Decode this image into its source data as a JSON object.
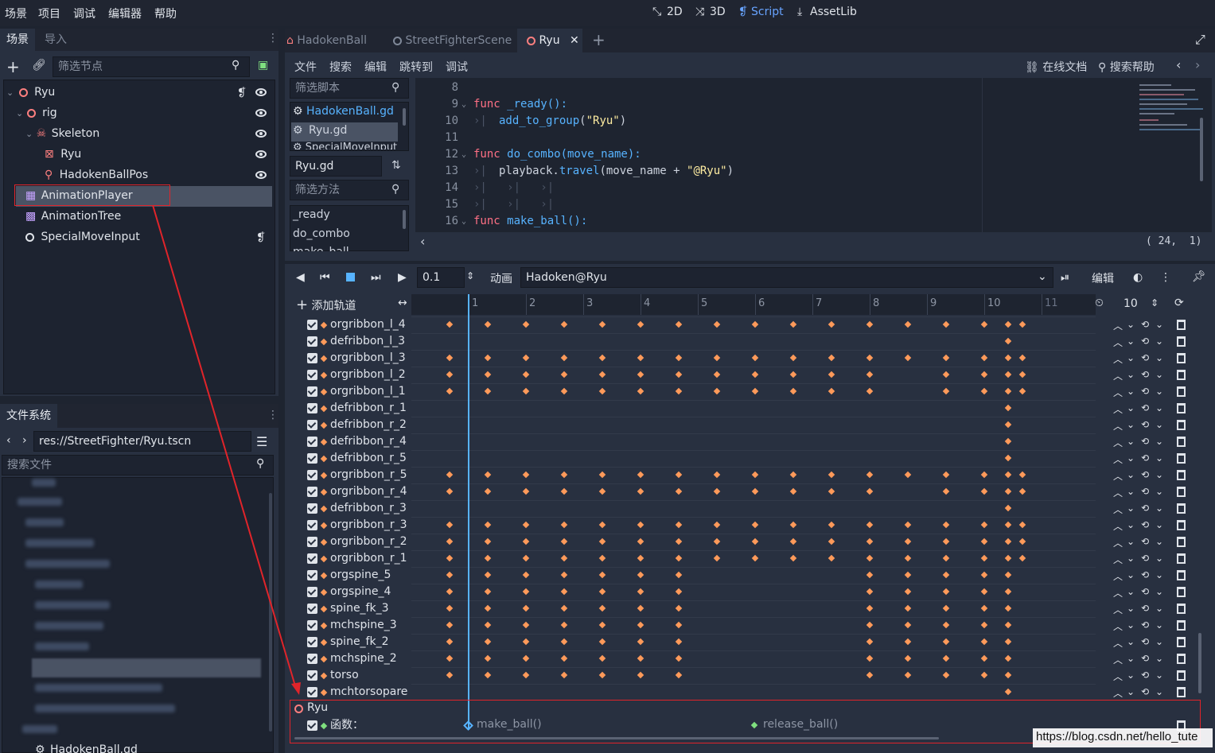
{
  "menu": [
    "场景",
    "项目",
    "调试",
    "编辑器",
    "帮助"
  ],
  "modes": [
    {
      "label": "2D",
      "icon": "2d-icon"
    },
    {
      "label": "3D",
      "icon": "3d-icon"
    },
    {
      "label": "Script",
      "icon": "script-icon"
    },
    {
      "label": "AssetLib",
      "icon": "assetlib-icon"
    }
  ],
  "scene_dock": {
    "tabs": [
      "场景",
      "导入"
    ],
    "filter_placeholder": "筛选节点",
    "tree": [
      {
        "label": "Ryu"
      },
      {
        "label": "rig"
      },
      {
        "label": "Skeleton"
      },
      {
        "label": "Ryu"
      },
      {
        "label": "HadokenBallPos"
      },
      {
        "label": "AnimationPlayer"
      },
      {
        "label": "AnimationTree"
      },
      {
        "label": "SpecialMoveInput"
      }
    ]
  },
  "filesystem": {
    "tab": "文件系统",
    "path": "res://StreetFighter/Ryu.tscn",
    "search_placeholder": "搜索文件",
    "last_item": "HadokenBall.gd"
  },
  "editor_tabs": [
    "HadokenBall",
    "StreetFighterScene",
    "Ryu"
  ],
  "script_menu": [
    "文件",
    "搜索",
    "编辑",
    "跳转到",
    "调试"
  ],
  "script_actions": {
    "online_docs": "在线文档",
    "search_help": "搜索帮助"
  },
  "script_list": {
    "filter_placeholder": "筛选脚本",
    "items": [
      "HadokenBall.gd",
      "Ryu.gd",
      "SpecialMoveInput"
    ],
    "current": "Ryu.gd",
    "method_filter_placeholder": "筛选方法",
    "methods": [
      "_ready",
      "do_combo",
      "make_ball"
    ]
  },
  "code": {
    "line_numbers": [
      "8",
      "9",
      "10",
      "11",
      "12",
      "13",
      "14",
      "15",
      "16"
    ],
    "l9_kw": "func",
    "l9_rest": " _ready():",
    "l10_fn": "add_to_group",
    "l10_open": "(",
    "l10_str": "\"Ryu\"",
    "l10_close": ")",
    "l12_kw": "func",
    "l12_rest": " do_combo(move_name):",
    "l13_a": "playback.",
    "l13_fn": "travel",
    "l13_b": "(move_name + ",
    "l13_str": "\"@Ryu\"",
    "l13_c": ")",
    "l16_kw": "func",
    "l16_rest": " make_ball():",
    "cursor": "( 24,  1)"
  },
  "anim_toolbar": {
    "step_value": "0.1",
    "anim_label": "动画",
    "anim_name": "Hadoken@Ryu",
    "edit_label": "编辑",
    "add_track": "添加轨道",
    "ruler_ticks": [
      "1",
      "2",
      "3",
      "4",
      "5",
      "6",
      "7",
      "8",
      "9",
      "10",
      "11"
    ],
    "zoom_value": "10"
  },
  "tracks": [
    {
      "name": "orgribbon_l_4",
      "pattern": "full"
    },
    {
      "name": "defribbon_l_3",
      "pattern": "end"
    },
    {
      "name": "orgribbon_l_3",
      "pattern": "full"
    },
    {
      "name": "orgribbon_l_2",
      "pattern": "gap"
    },
    {
      "name": "orgribbon_l_1",
      "pattern": "gap"
    },
    {
      "name": "defribbon_r_1",
      "pattern": "end"
    },
    {
      "name": "defribbon_r_2",
      "pattern": "end"
    },
    {
      "name": "defribbon_r_4",
      "pattern": "end"
    },
    {
      "name": "defribbon_r_5",
      "pattern": "end"
    },
    {
      "name": "orgribbon_r_5",
      "pattern": "full"
    },
    {
      "name": "orgribbon_r_4",
      "pattern": "gap"
    },
    {
      "name": "defribbon_r_3",
      "pattern": "end"
    },
    {
      "name": "orgribbon_r_3",
      "pattern": "full"
    },
    {
      "name": "orgribbon_r_2",
      "pattern": "full"
    },
    {
      "name": "orgribbon_r_1",
      "pattern": "full"
    },
    {
      "name": "orgspine_5",
      "pattern": "split"
    },
    {
      "name": "orgspine_4",
      "pattern": "split2"
    },
    {
      "name": "spine_fk_3",
      "pattern": "split2"
    },
    {
      "name": "mchspine_3",
      "pattern": "split2"
    },
    {
      "name": "spine_fk_2",
      "pattern": "split2"
    },
    {
      "name": "mchspine_2",
      "pattern": "split2"
    },
    {
      "name": "torso",
      "pattern": "split2"
    },
    {
      "name": "mchtorsopare",
      "pattern": "end"
    }
  ],
  "method_track": {
    "node": "Ryu",
    "label": "函数：",
    "keys": [
      "make_ball()",
      "release_ball()"
    ]
  },
  "watermark": "https://blog.csdn.net/hello_tute",
  "colors": {
    "accent": "#57b3ff",
    "key": "#ff9a5a",
    "annotation": "#e0242a"
  }
}
